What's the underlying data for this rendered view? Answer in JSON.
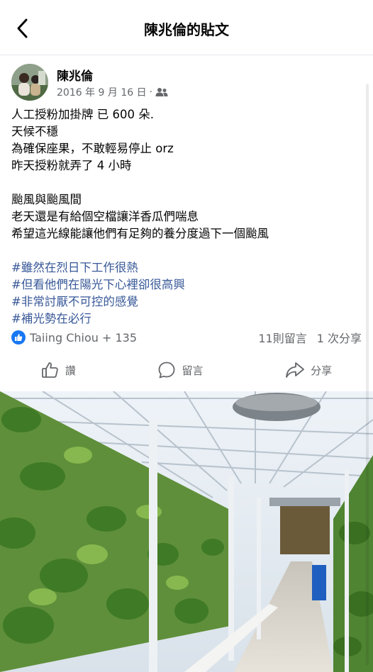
{
  "header": {
    "title": "陳兆倫的貼文"
  },
  "post": {
    "author": "陳兆倫",
    "date": "2016 年 9 月 16 日",
    "separator": "·",
    "lines": [
      "人工授粉加掛牌 已 600 朵.",
      "天候不穩",
      "為確保座果，不敢輕易停止 orz",
      "昨天授粉就弄了 4 小時"
    ],
    "lines2": [
      "颱風與颱風間",
      "老天還是有給個空檔讓洋香瓜們喘息",
      "希望這光線能讓他們有足夠的養分度過下一個颱風"
    ],
    "hashtags": [
      "#雖然在烈日下工作很熱",
      "#但看他們在陽光下心裡卻很高興",
      "#非常討厭不可控的感覺",
      "#補光勢在必行"
    ]
  },
  "reactions": {
    "names": "Taiing Chiou + 135",
    "comments": "11則留言",
    "shares": "1 次分享"
  },
  "actions": {
    "like": "讚",
    "comment": "留言",
    "share": "分享"
  },
  "icons": {
    "back": "chevron-left-icon",
    "audience": "friends-icon",
    "like_badge": "thumbs-up-icon",
    "like": "thumbs-up-icon",
    "comment": "speech-bubble-icon",
    "share": "share-arrow-icon"
  },
  "colors": {
    "accent": "#1877f2",
    "hashtag": "#385898",
    "muted": "#65676b"
  }
}
